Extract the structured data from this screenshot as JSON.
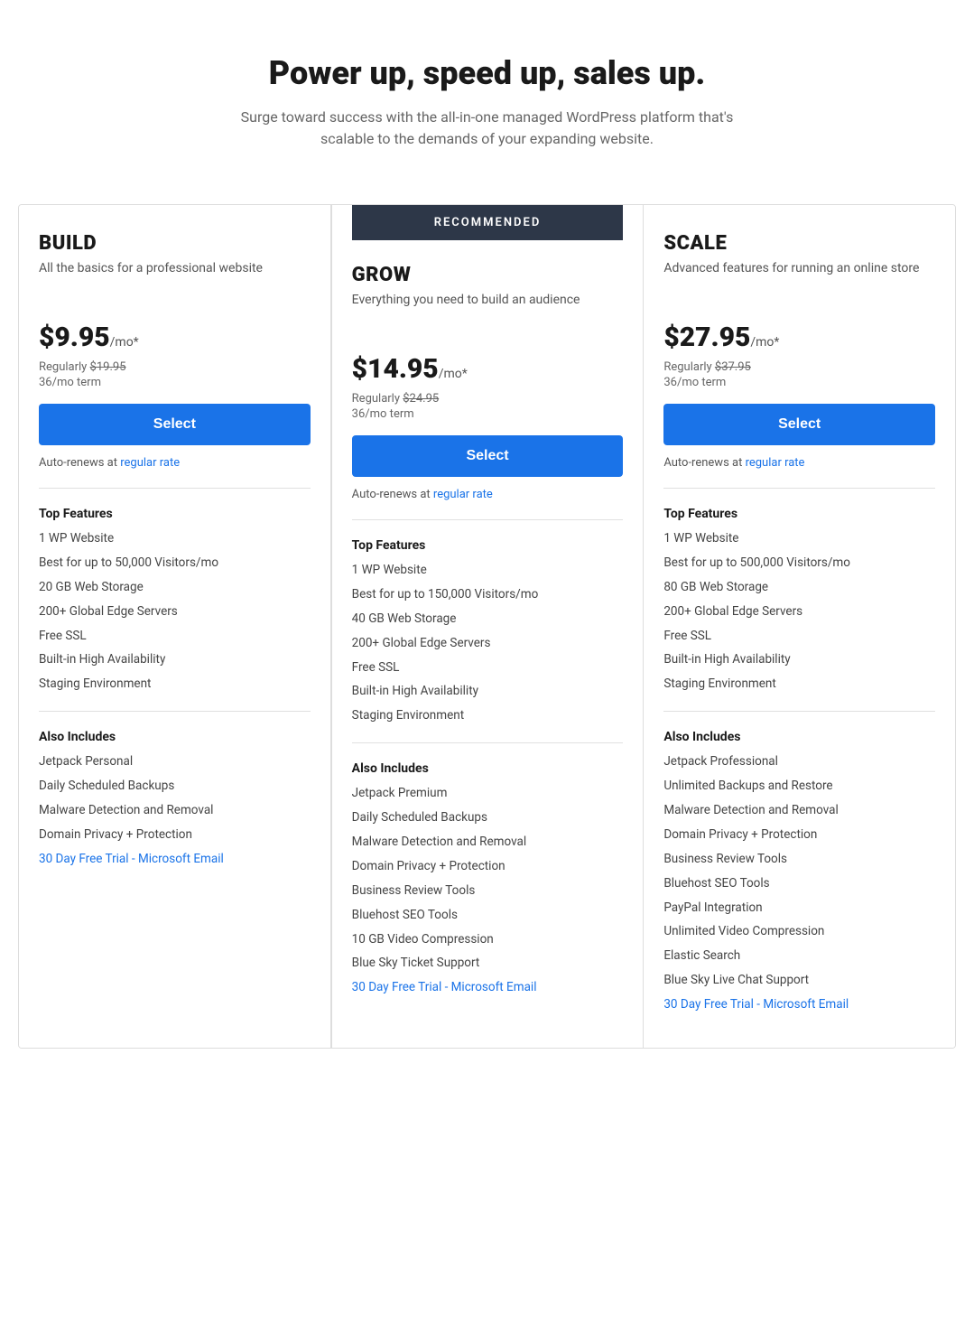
{
  "header": {
    "title": "Power up, speed up, sales up.",
    "subtitle": "Surge toward success with the all-in-one managed WordPress platform that's scalable to the demands of your expanding website."
  },
  "recommended_label": "RECOMMENDED",
  "plans": [
    {
      "id": "build",
      "name": "BUILD",
      "description": "All the basics for a professional website",
      "price": "$9.95",
      "price_suffix": "/mo*",
      "regular_price": "$19.95",
      "term": "36/mo term",
      "select_label": "Select",
      "auto_renews": "Auto-renews at",
      "regular_rate_link": "regular rate",
      "top_features_heading": "Top Features",
      "top_features": [
        "1 WP Website",
        "Best for up to 50,000 Visitors/mo",
        "20 GB Web Storage",
        "200+ Global Edge Servers",
        "Free SSL",
        "Built-in High Availability",
        "Staging Environment"
      ],
      "also_includes_heading": "Also Includes",
      "also_includes": [
        "Jetpack Personal",
        "Daily Scheduled Backups",
        "Malware Detection and Removal",
        "Domain Privacy + Protection",
        "30 Day Free Trial - Microsoft Email"
      ],
      "email_link_index": 4
    },
    {
      "id": "grow",
      "name": "GROW",
      "description": "Everything you need to build an audience",
      "price": "$14.95",
      "price_suffix": "/mo*",
      "regular_price": "$24.95",
      "term": "36/mo term",
      "select_label": "Select",
      "auto_renews": "Auto-renews at",
      "regular_rate_link": "regular rate",
      "top_features_heading": "Top Features",
      "top_features": [
        "1 WP Website",
        "Best for up to 150,000 Visitors/mo",
        "40 GB Web Storage",
        "200+ Global Edge Servers",
        "Free SSL",
        "Built-in High Availability",
        "Staging Environment"
      ],
      "also_includes_heading": "Also Includes",
      "also_includes": [
        "Jetpack Premium",
        "Daily Scheduled Backups",
        "Malware Detection and Removal",
        "Domain Privacy + Protection",
        "Business Review Tools",
        "Bluehost SEO Tools",
        "10 GB Video Compression",
        "Blue Sky Ticket Support",
        "30 Day Free Trial - Microsoft Email"
      ],
      "email_link_index": 8
    },
    {
      "id": "scale",
      "name": "SCALE",
      "description": "Advanced features for running an online store",
      "price": "$27.95",
      "price_suffix": "/mo*",
      "regular_price": "$37.95",
      "term": "36/mo term",
      "select_label": "Select",
      "auto_renews": "Auto-renews at",
      "regular_rate_link": "regular rate",
      "top_features_heading": "Top Features",
      "top_features": [
        "1 WP Website",
        "Best for up to 500,000 Visitors/mo",
        "80 GB Web Storage",
        "200+ Global Edge Servers",
        "Free SSL",
        "Built-in High Availability",
        "Staging Environment"
      ],
      "also_includes_heading": "Also Includes",
      "also_includes": [
        "Jetpack Professional",
        "Unlimited Backups and Restore",
        "Malware Detection and Removal",
        "Domain Privacy + Protection",
        "Business Review Tools",
        "Bluehost SEO Tools",
        "PayPal Integration",
        "Unlimited Video Compression",
        "Elastic Search",
        "Blue Sky Live Chat Support",
        "30 Day Free Trial - Microsoft Email"
      ],
      "email_link_index": 10
    }
  ]
}
